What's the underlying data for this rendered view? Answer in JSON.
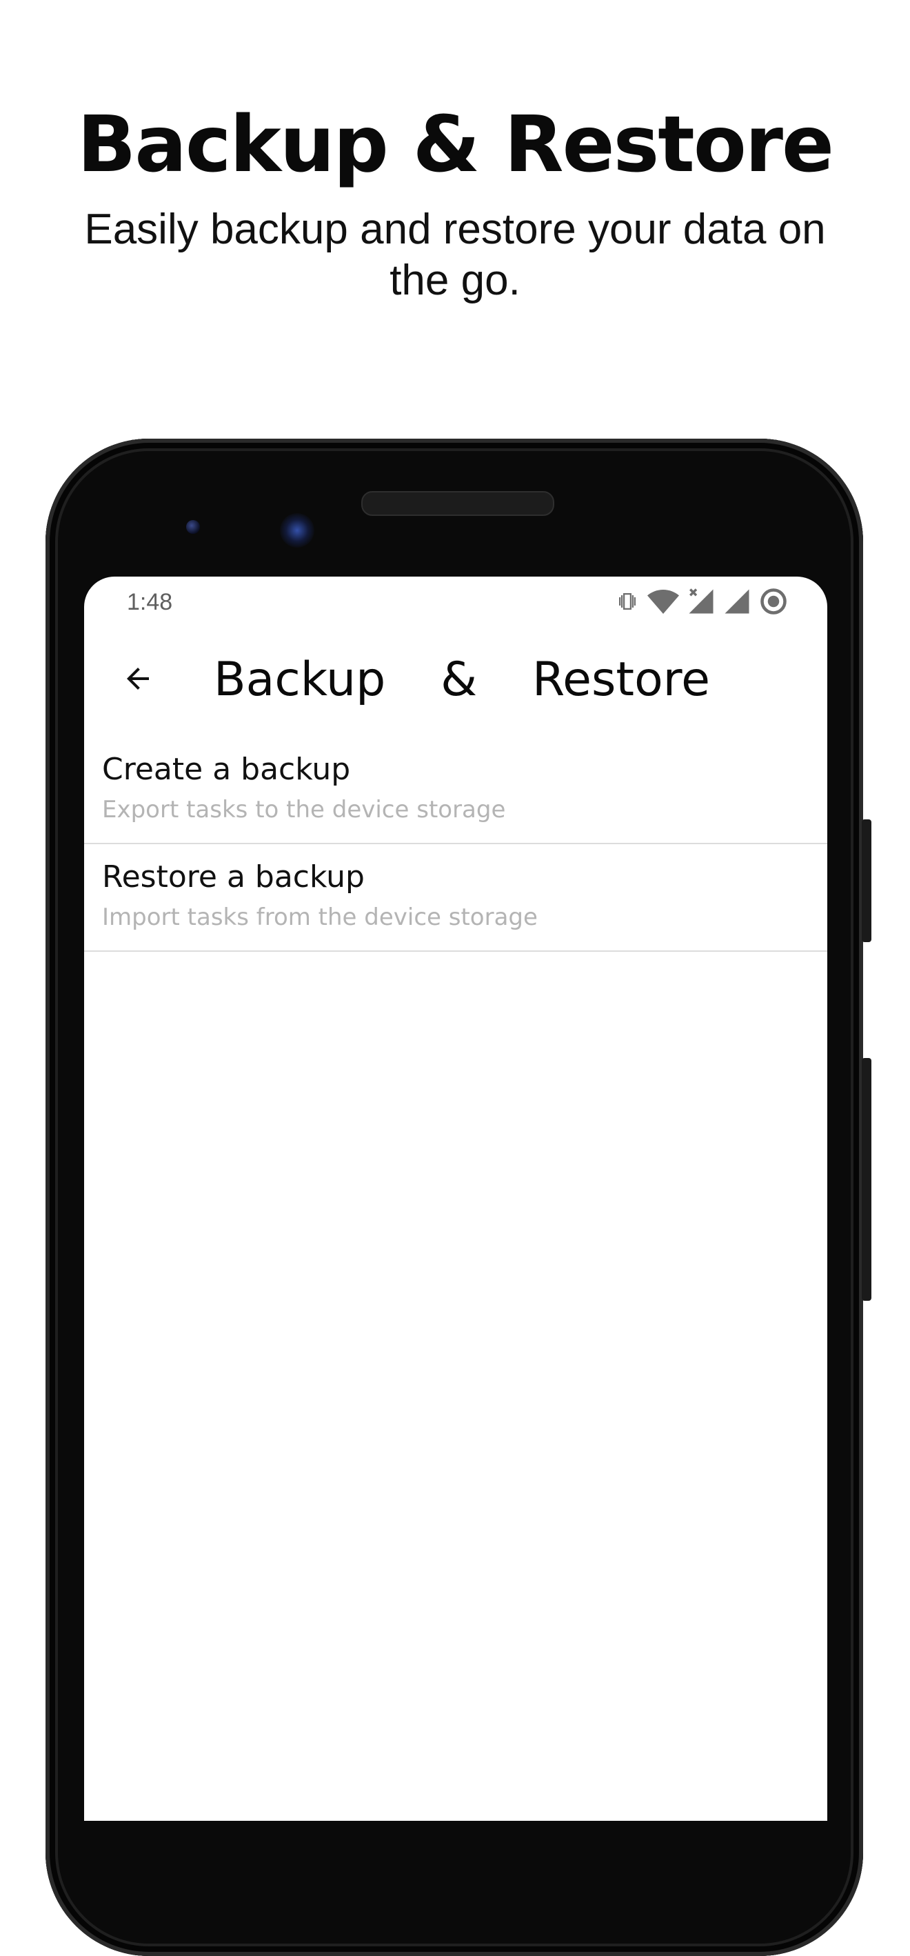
{
  "promo": {
    "title": "Backup & Restore",
    "subtitle": "Easily backup and restore your data on the go."
  },
  "status_bar": {
    "time": "1:48",
    "icons": [
      "vibrate-icon",
      "wifi-icon",
      "signal-no-data-icon",
      "signal-icon",
      "sync-circle-icon"
    ]
  },
  "app_bar": {
    "back_icon": "arrow-left-icon",
    "title_words": [
      "Backup",
      "&",
      "Restore"
    ]
  },
  "preferences": [
    {
      "title": "Create a backup",
      "summary": "Export tasks to the device storage"
    },
    {
      "title": "Restore a backup",
      "summary": "Import tasks from the device storage"
    }
  ],
  "colors": {
    "background": "#ffffff",
    "text_primary": "#111111",
    "text_secondary": "#b4b4b4",
    "divider": "#dcdcdc",
    "phone_frame": "#0a0a0a"
  }
}
